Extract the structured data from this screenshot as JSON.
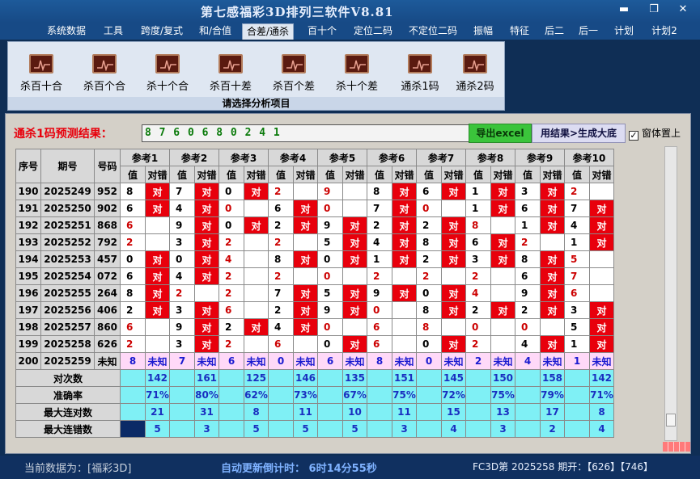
{
  "window": {
    "title": "第七感福彩3D排列三软件V8.81"
  },
  "menu": {
    "items": [
      "系统数据",
      "工具",
      "跨度/复式",
      "和/合值",
      "合差/通杀",
      "百十个",
      "定位二码",
      "不定位二码",
      "振幅",
      "特征",
      "后二",
      "后一",
      "计划",
      "计划2"
    ],
    "active_index": 4
  },
  "ribbon": {
    "buttons": [
      "杀百十合",
      "杀百个合",
      "杀十个合",
      "杀百十差",
      "杀百个差",
      "杀十个差",
      "通杀1码",
      "通杀2码"
    ],
    "caption": "请选择分析项目"
  },
  "result": {
    "label": "通杀1码预测结果：",
    "value": "8 7 6 0 6 8 0 2 4 1",
    "export_button": "导出excel",
    "generate_button": "用结果>生成大底",
    "topmost_label": "窗体置上"
  },
  "table": {
    "headers": {
      "seq": "序号",
      "period": "期号",
      "number": "号码",
      "value": "值",
      "result": "对错"
    },
    "refs": [
      "参考1",
      "参考2",
      "参考3",
      "参考4",
      "参考5",
      "参考6",
      "参考7",
      "参考8",
      "参考9",
      "参考10"
    ],
    "dui": "对",
    "rows": [
      {
        "seq": "190",
        "period": "2025249",
        "number": "952",
        "refs": [
          [
            "8",
            1
          ],
          [
            "7",
            1
          ],
          [
            "0",
            1
          ],
          [
            "2",
            0
          ],
          [
            "9",
            0
          ],
          [
            "8",
            1
          ],
          [
            "6",
            1
          ],
          [
            "1",
            1
          ],
          [
            "3",
            1
          ],
          [
            "2",
            0
          ]
        ]
      },
      {
        "seq": "191",
        "period": "2025250",
        "number": "902",
        "refs": [
          [
            "6",
            1
          ],
          [
            "4",
            1
          ],
          [
            "0",
            0
          ],
          [
            "6",
            1
          ],
          [
            "0",
            0
          ],
          [
            "7",
            1
          ],
          [
            "0",
            0
          ],
          [
            "1",
            1
          ],
          [
            "6",
            1
          ],
          [
            "7",
            1
          ]
        ]
      },
      {
        "seq": "192",
        "period": "2025251",
        "number": "868",
        "refs": [
          [
            "6",
            0
          ],
          [
            "9",
            1
          ],
          [
            "0",
            1
          ],
          [
            "2",
            1
          ],
          [
            "9",
            1
          ],
          [
            "2",
            1
          ],
          [
            "2",
            1
          ],
          [
            "8",
            0
          ],
          [
            "1",
            1
          ],
          [
            "4",
            1
          ]
        ]
      },
      {
        "seq": "193",
        "period": "2025252",
        "number": "792",
        "refs": [
          [
            "2",
            0
          ],
          [
            "3",
            1
          ],
          [
            "2",
            0
          ],
          [
            "2",
            0
          ],
          [
            "5",
            1
          ],
          [
            "4",
            1
          ],
          [
            "8",
            1
          ],
          [
            "6",
            1
          ],
          [
            "2",
            0
          ],
          [
            "1",
            1
          ]
        ]
      },
      {
        "seq": "194",
        "period": "2025253",
        "number": "457",
        "refs": [
          [
            "0",
            1
          ],
          [
            "0",
            1
          ],
          [
            "4",
            0
          ],
          [
            "8",
            1
          ],
          [
            "0",
            1
          ],
          [
            "1",
            1
          ],
          [
            "2",
            1
          ],
          [
            "3",
            1
          ],
          [
            "8",
            1
          ],
          [
            "5",
            0
          ]
        ]
      },
      {
        "seq": "195",
        "period": "2025254",
        "number": "072",
        "refs": [
          [
            "6",
            1
          ],
          [
            "4",
            1
          ],
          [
            "2",
            0
          ],
          [
            "2",
            0
          ],
          [
            "0",
            0
          ],
          [
            "2",
            0
          ],
          [
            "2",
            0
          ],
          [
            "2",
            0
          ],
          [
            "6",
            1
          ],
          [
            "7",
            0
          ]
        ]
      },
      {
        "seq": "196",
        "period": "2025255",
        "number": "264",
        "refs": [
          [
            "8",
            1
          ],
          [
            "2",
            0
          ],
          [
            "2",
            0
          ],
          [
            "7",
            1
          ],
          [
            "5",
            1
          ],
          [
            "9",
            1
          ],
          [
            "0",
            1
          ],
          [
            "4",
            0
          ],
          [
            "9",
            1
          ],
          [
            "6",
            0
          ]
        ]
      },
      {
        "seq": "197",
        "period": "2025256",
        "number": "406",
        "refs": [
          [
            "2",
            1
          ],
          [
            "3",
            1
          ],
          [
            "6",
            0
          ],
          [
            "2",
            1
          ],
          [
            "9",
            1
          ],
          [
            "0",
            0
          ],
          [
            "8",
            1
          ],
          [
            "2",
            1
          ],
          [
            "2",
            1
          ],
          [
            "3",
            1
          ]
        ]
      },
      {
        "seq": "198",
        "period": "2025257",
        "number": "860",
        "refs": [
          [
            "6",
            0
          ],
          [
            "9",
            1
          ],
          [
            "2",
            1
          ],
          [
            "4",
            1
          ],
          [
            "0",
            0
          ],
          [
            "6",
            0
          ],
          [
            "8",
            0
          ],
          [
            "0",
            0
          ],
          [
            "0",
            0
          ],
          [
            "5",
            1
          ]
        ]
      },
      {
        "seq": "199",
        "period": "2025258",
        "number": "626",
        "refs": [
          [
            "2",
            0
          ],
          [
            "3",
            1
          ],
          [
            "2",
            0
          ],
          [
            "6",
            0
          ],
          [
            "0",
            1
          ],
          [
            "6",
            0
          ],
          [
            "0",
            1
          ],
          [
            "2",
            0
          ],
          [
            "4",
            1
          ],
          [
            "1",
            1
          ]
        ]
      }
    ],
    "pending": {
      "seq": "200",
      "period": "2025259",
      "number": "未知",
      "values": [
        "8",
        "7",
        "6",
        "0",
        "6",
        "8",
        "0",
        "2",
        "4",
        "1"
      ],
      "result": "未知"
    },
    "stats": [
      {
        "label": "对次数",
        "values": [
          "142",
          "161",
          "125",
          "146",
          "135",
          "151",
          "145",
          "150",
          "158",
          "142"
        ]
      },
      {
        "label": "准确率",
        "values": [
          "71%",
          "80%",
          "62%",
          "73%",
          "67%",
          "75%",
          "72%",
          "75%",
          "79%",
          "71%"
        ]
      },
      {
        "label": "最大连对数",
        "values": [
          "21",
          "31",
          "8",
          "11",
          "10",
          "11",
          "15",
          "13",
          "17",
          "8"
        ]
      },
      {
        "label": "最大连错数",
        "values": [
          "5",
          "3",
          "5",
          "5",
          "5",
          "3",
          "4",
          "3",
          "2",
          "4"
        ]
      }
    ]
  },
  "status": {
    "left": "当前数据为：[福彩3D]",
    "mid": "自动更新倒计时：  6时14分55秒",
    "right": "FC3D第 2025258 期开：【626】【746】"
  },
  "colors": {
    "dui": "#e8000c",
    "pending": "#ffd9f8",
    "stats": "#7ff0f5",
    "export": "#3bc43b"
  }
}
